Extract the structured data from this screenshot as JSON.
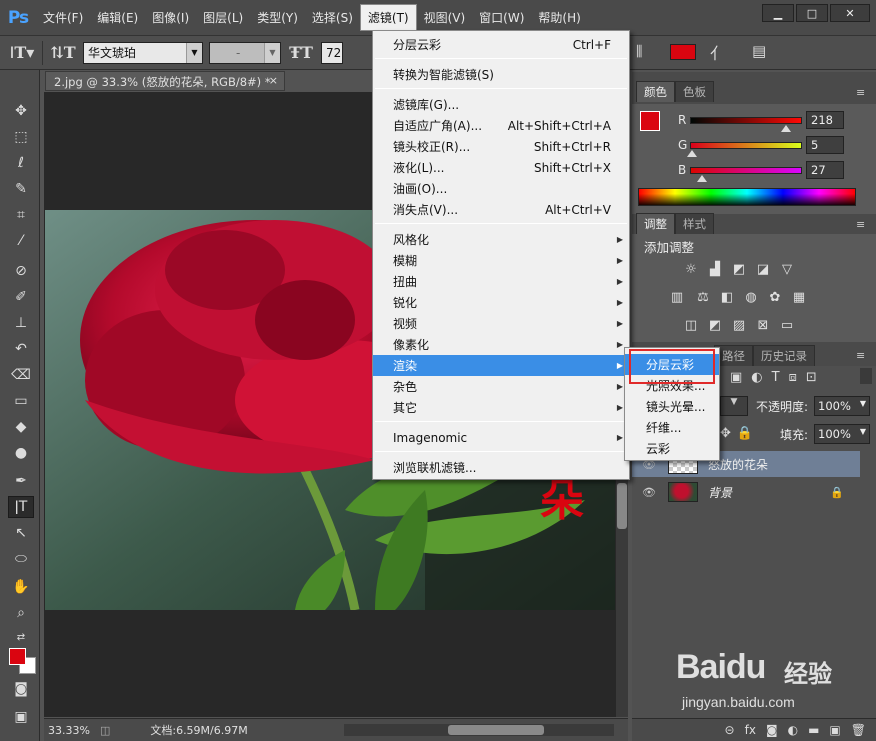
{
  "app": {
    "logo": "Ps"
  },
  "menubar": {
    "items": [
      {
        "label": "文件(F)"
      },
      {
        "label": "编辑(E)"
      },
      {
        "label": "图像(I)"
      },
      {
        "label": "图层(L)"
      },
      {
        "label": "类型(Y)"
      },
      {
        "label": "选择(S)"
      },
      {
        "label": "滤镜(T)",
        "active": true
      },
      {
        "label": "视图(V)"
      },
      {
        "label": "窗口(W)"
      },
      {
        "label": "帮助(H)"
      }
    ]
  },
  "options": {
    "font_family": "华文琥珀",
    "font_style": "-",
    "font_size": "72",
    "text_color": "#da0510"
  },
  "document": {
    "tab_title": "2.jpg @ 33.3% (怒放的花朵, RGB/8#) *",
    "close": "×"
  },
  "statusbar": {
    "zoom": "33.33%",
    "doc_info": "文档:6.59M/6.97M"
  },
  "filter_menu": {
    "items": [
      {
        "label": "分层云彩",
        "shortcut": "Ctrl+F"
      },
      {
        "label": "转换为智能滤镜(S)",
        "shortcut": ""
      },
      {
        "label": "滤镜库(G)...",
        "shortcut": ""
      },
      {
        "label": "自适应广角(A)...",
        "shortcut": "Alt+Shift+Ctrl+A"
      },
      {
        "label": "镜头校正(R)...",
        "shortcut": "Shift+Ctrl+R"
      },
      {
        "label": "液化(L)...",
        "shortcut": "Shift+Ctrl+X"
      },
      {
        "label": "油画(O)...",
        "shortcut": ""
      },
      {
        "label": "消失点(V)...",
        "shortcut": "Alt+Ctrl+V"
      },
      {
        "label": "风格化",
        "submenu": true
      },
      {
        "label": "模糊",
        "submenu": true
      },
      {
        "label": "扭曲",
        "submenu": true
      },
      {
        "label": "锐化",
        "submenu": true
      },
      {
        "label": "视频",
        "submenu": true
      },
      {
        "label": "像素化",
        "submenu": true
      },
      {
        "label": "渲染",
        "submenu": true,
        "highlighted": true
      },
      {
        "label": "杂色",
        "submenu": true
      },
      {
        "label": "其它",
        "submenu": true
      },
      {
        "label": "Imagenomic",
        "submenu": true
      },
      {
        "label": "浏览联机滤镜..."
      }
    ]
  },
  "render_submenu": {
    "items": [
      {
        "label": "分层云彩",
        "highlighted": true
      },
      {
        "label": "光照效果..."
      },
      {
        "label": "镜头光晕..."
      },
      {
        "label": "纤维..."
      },
      {
        "label": "云彩"
      }
    ]
  },
  "color_panel": {
    "tabs": [
      "颜色",
      "色板"
    ],
    "r_label": "R",
    "r_value": "218",
    "r_fraction": 0.855,
    "g_label": "G",
    "g_value": "5",
    "g_fraction": 0.02,
    "b_label": "B",
    "b_value": "27",
    "b_fraction": 0.106,
    "foreground": "#da0510",
    "background": "#ffffff"
  },
  "adjustments_panel": {
    "tabs": [
      "调整",
      "样式"
    ],
    "title": "添加调整"
  },
  "layers_panel": {
    "tabs": [
      "路径",
      "历史记录"
    ],
    "opacity_label": "不透明度:",
    "opacity_value": "100%",
    "fill_label": "填充:",
    "fill_value": "100%",
    "layers": [
      {
        "name": "怒放的花朵",
        "selected": true
      },
      {
        "name": "背景",
        "locked": true
      }
    ]
  },
  "watermark": {
    "logo": "Baidu",
    "brand": "经验",
    "url": "jingyan.baidu.com"
  }
}
